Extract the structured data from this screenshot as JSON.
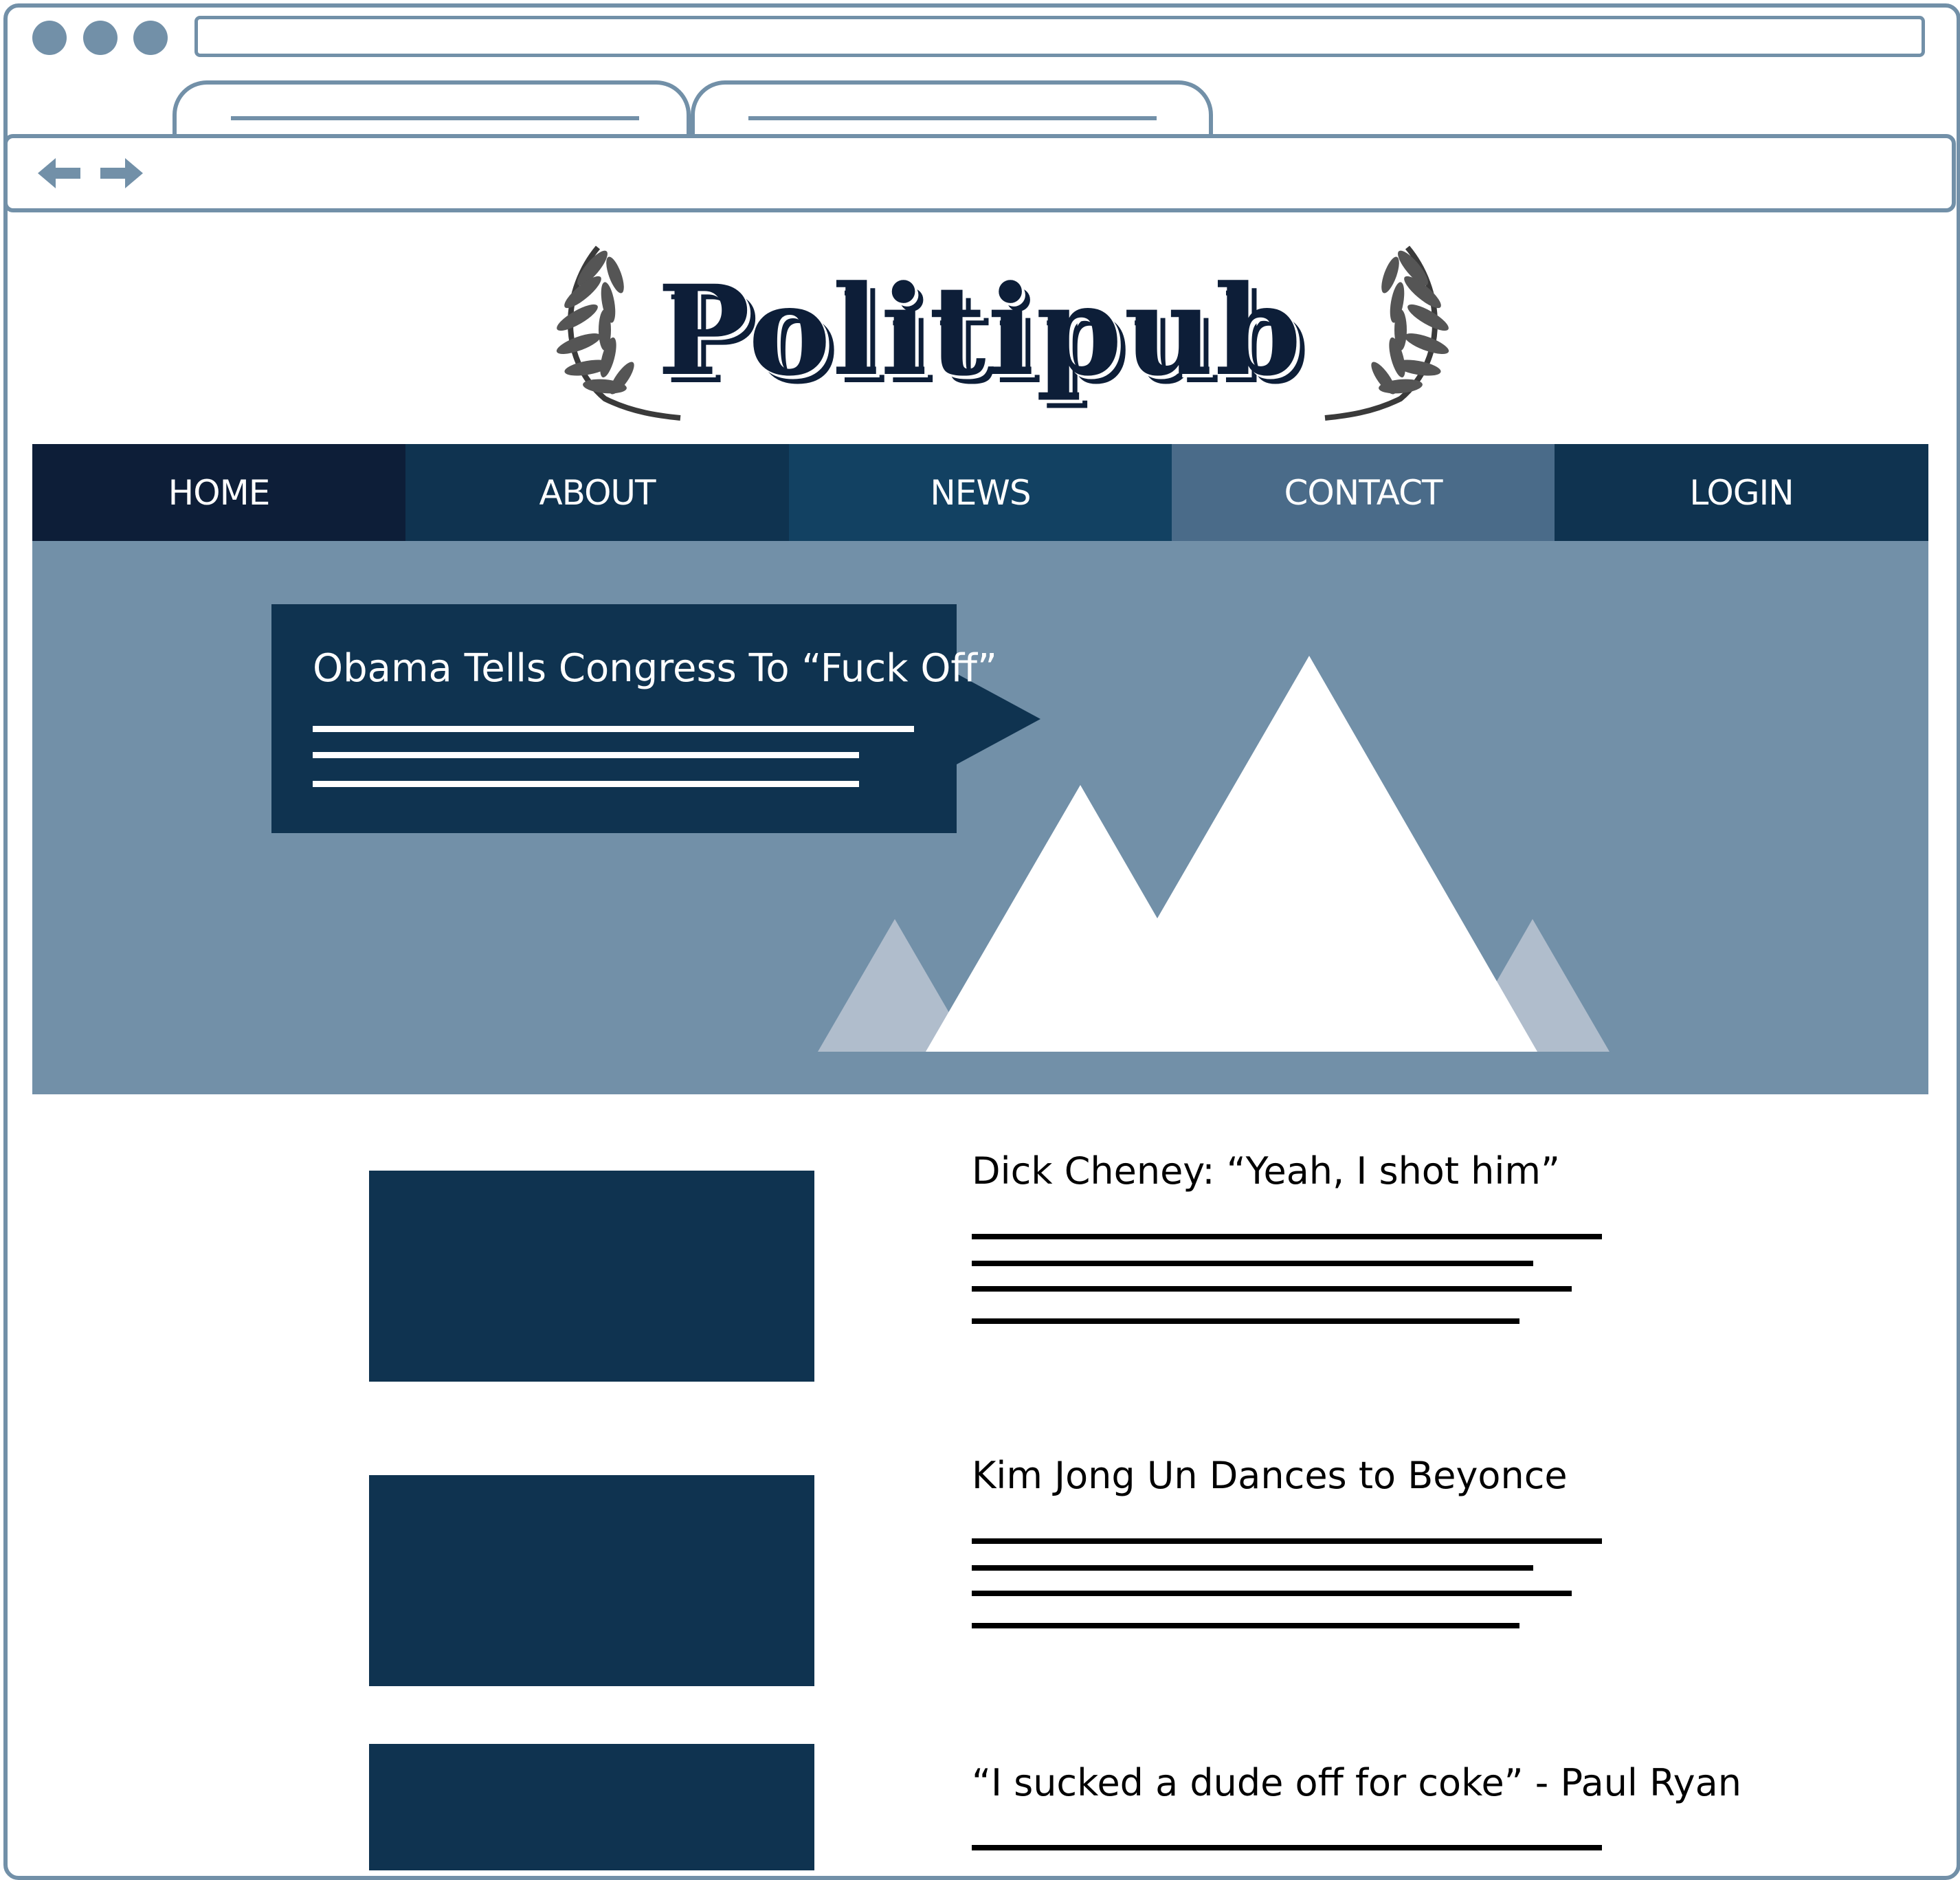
{
  "browser": {
    "window_controls": [
      "control-dot-1",
      "control-dot-2",
      "control-dot-3"
    ],
    "tabs": [
      "tab-1",
      "tab-2"
    ],
    "navigation_icons": [
      "back-arrow-icon",
      "forward-arrow-icon"
    ]
  },
  "site": {
    "logo_text": "Politipub",
    "logo_decoration": "laurel-icon"
  },
  "nav": {
    "items": [
      {
        "label": "HOME",
        "color": "#0d1e38"
      },
      {
        "label": "ABOUT",
        "color": "#0f3350"
      },
      {
        "label": "NEWS",
        "color": "#124162"
      },
      {
        "label": "CONTACT",
        "color": "#4a6b89"
      },
      {
        "label": "LOGIN",
        "color": "#0f3350"
      }
    ]
  },
  "hero": {
    "headline": "Obama Tells Congress To “Fuck Off”",
    "image_placeholder": "mountain-image-icon"
  },
  "articles": [
    {
      "title": "Dick Cheney: “Yeah, I shot him”"
    },
    {
      "title": "Kim Jong Un Dances to Beyonce"
    },
    {
      "title": "“I sucked a dude off for coke” - Paul Ryan"
    }
  ],
  "colors": {
    "frame": "#7290a8",
    "hero_background": "#7290a8",
    "dark_navy": "#0f3350",
    "logo": "#0d1e38"
  }
}
